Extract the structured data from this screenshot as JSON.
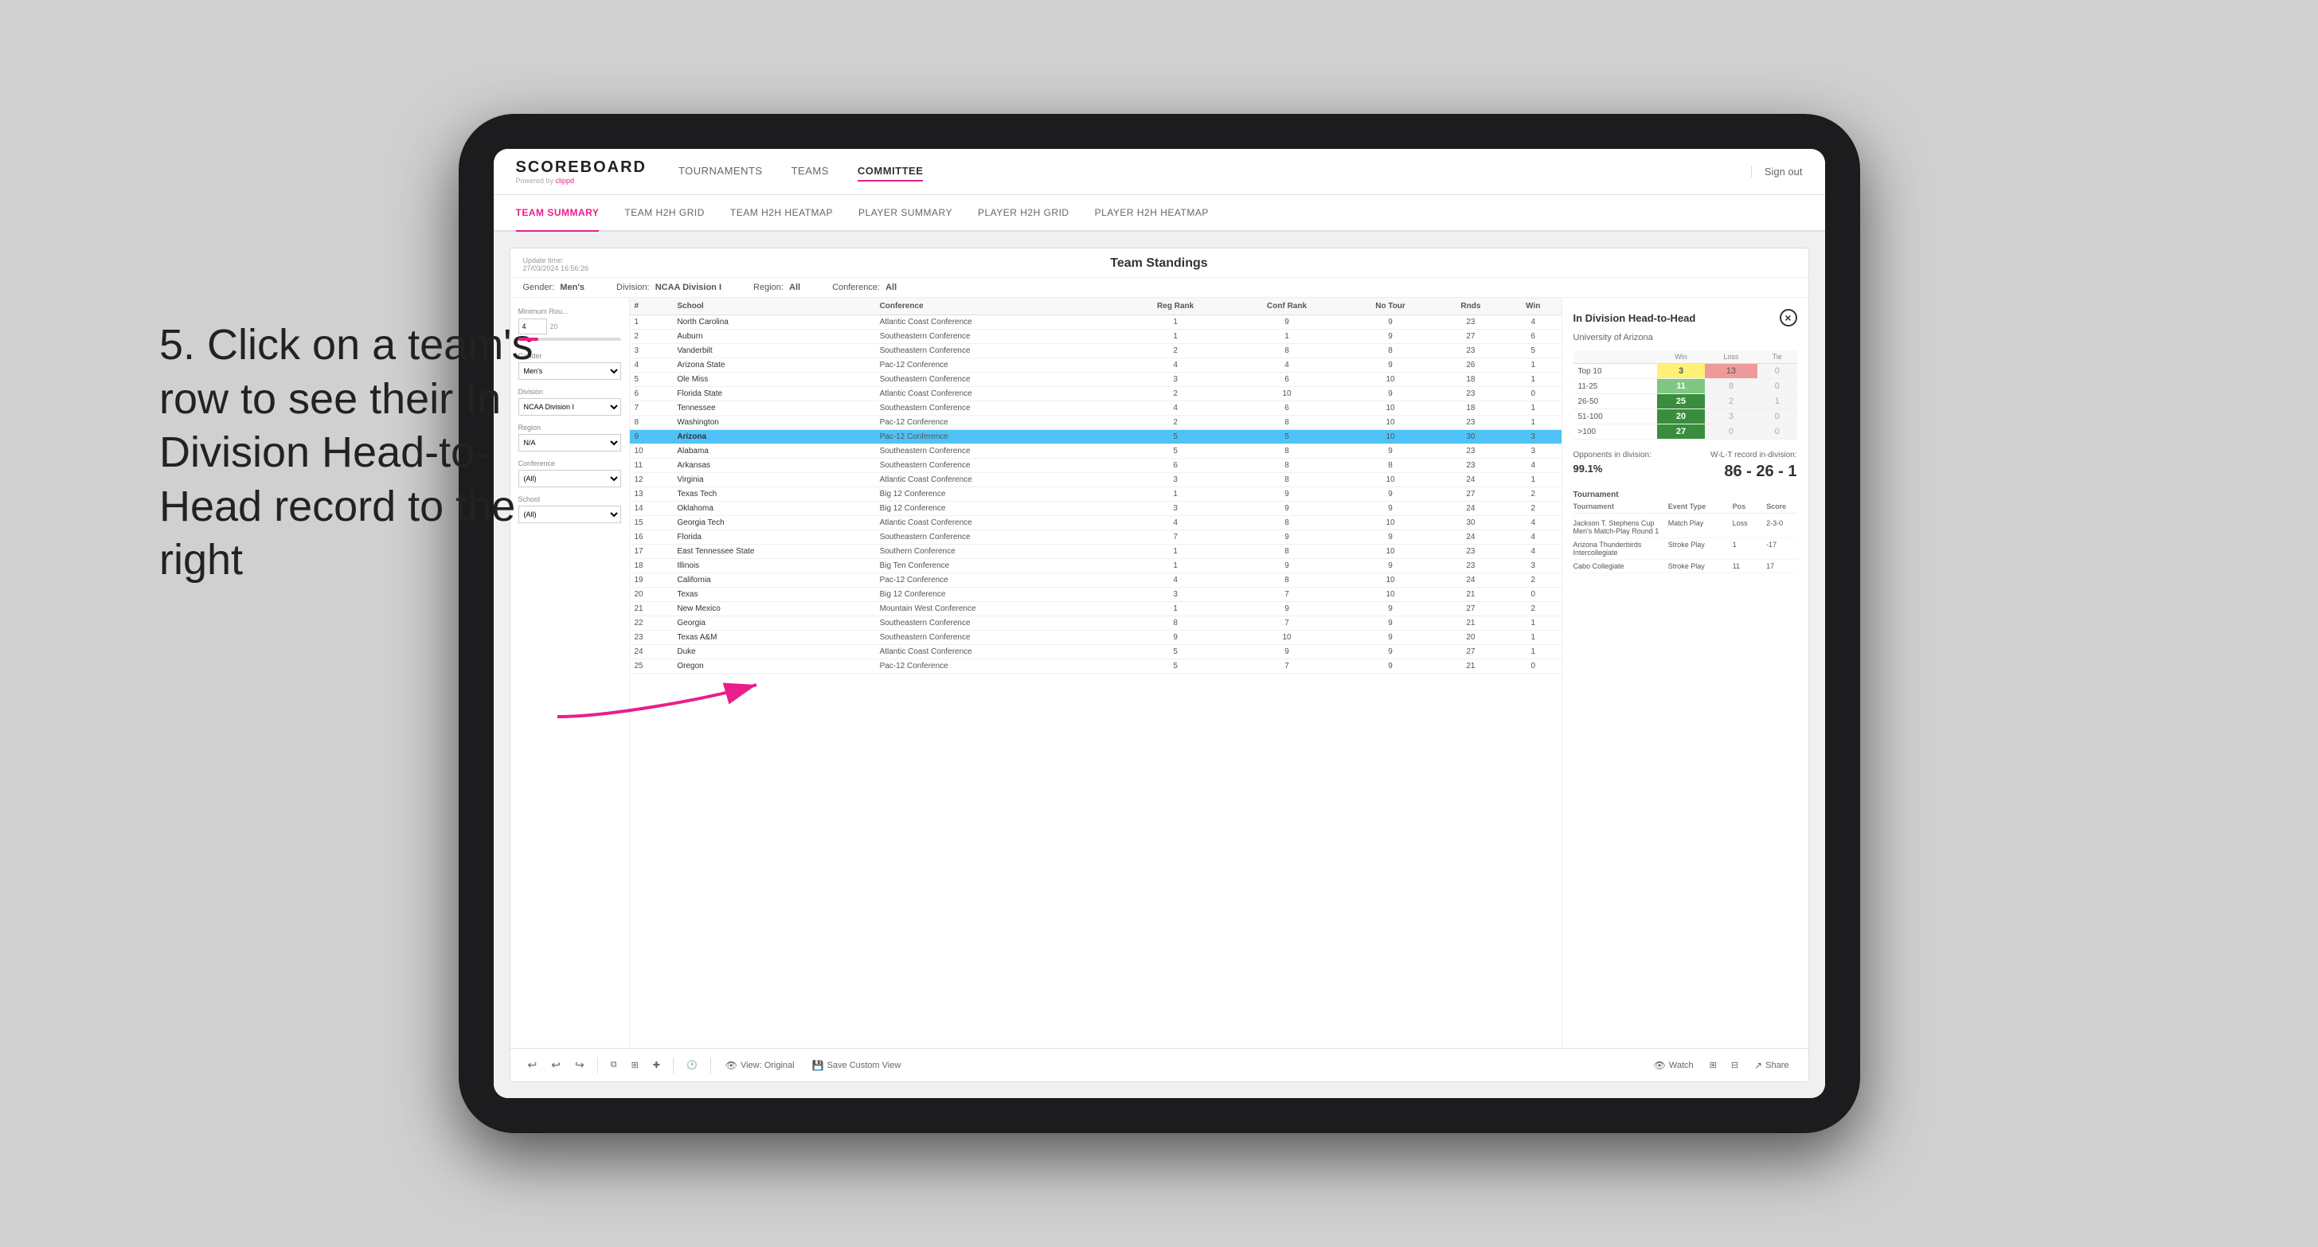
{
  "app": {
    "title": "SCOREBOARD",
    "subtitle": "Powered by clippd",
    "sign_out": "Sign out"
  },
  "main_nav": [
    {
      "id": "tournaments",
      "label": "TOURNAMENTS",
      "active": false
    },
    {
      "id": "teams",
      "label": "TEAMS",
      "active": false
    },
    {
      "id": "committee",
      "label": "COMMITTEE",
      "active": true
    }
  ],
  "sub_nav": [
    {
      "id": "team-summary",
      "label": "TEAM SUMMARY",
      "active": true
    },
    {
      "id": "team-h2h-grid",
      "label": "TEAM H2H GRID",
      "active": false
    },
    {
      "id": "team-h2h-heatmap",
      "label": "TEAM H2H HEATMAP",
      "active": false
    },
    {
      "id": "player-summary",
      "label": "PLAYER SUMMARY",
      "active": false
    },
    {
      "id": "player-h2h-grid",
      "label": "PLAYER H2H GRID",
      "active": false
    },
    {
      "id": "player-h2h-heatmap",
      "label": "PLAYER H2H HEATMAP",
      "active": false
    }
  ],
  "panel": {
    "update_time_label": "Update time:",
    "update_time": "27/03/2024 16:56:26",
    "title": "Team Standings",
    "gender_label": "Gender:",
    "gender": "Men's",
    "division_label": "Division:",
    "division": "NCAA Division I",
    "region_label": "Region:",
    "region": "All",
    "conference_label": "Conference:",
    "conference": "All"
  },
  "filters": {
    "min_rounds_label": "Minimum Rou...",
    "min_rounds_value": "4",
    "min_rounds_max": "20",
    "gender_label": "Gender",
    "gender_value": "Men's",
    "division_label": "Division",
    "division_value": "NCAA Division I",
    "region_label": "Region",
    "region_value": "N/A",
    "conference_label": "Conference",
    "conference_value": "(All)",
    "school_label": "School",
    "school_value": "(All)"
  },
  "table": {
    "columns": [
      "#",
      "School",
      "Conference",
      "Reg Rank",
      "Conf Rank",
      "No Tour",
      "Rnds",
      "Win"
    ],
    "rows": [
      {
        "num": "1",
        "school": "North Carolina",
        "conference": "Atlantic Coast Conference",
        "reg_rank": "1",
        "conf_rank": "9",
        "no_tour": "9",
        "rnds": "23",
        "win": "4"
      },
      {
        "num": "2",
        "school": "Auburn",
        "conference": "Southeastern Conference",
        "reg_rank": "1",
        "conf_rank": "1",
        "no_tour": "9",
        "rnds": "27",
        "win": "6"
      },
      {
        "num": "3",
        "school": "Vanderbilt",
        "conference": "Southeastern Conference",
        "reg_rank": "2",
        "conf_rank": "8",
        "no_tour": "8",
        "rnds": "23",
        "win": "5"
      },
      {
        "num": "4",
        "school": "Arizona State",
        "conference": "Pac-12 Conference",
        "reg_rank": "4",
        "conf_rank": "4",
        "no_tour": "9",
        "rnds": "26",
        "win": "1"
      },
      {
        "num": "5",
        "school": "Ole Miss",
        "conference": "Southeastern Conference",
        "reg_rank": "3",
        "conf_rank": "6",
        "no_tour": "10",
        "rnds": "18",
        "win": "1"
      },
      {
        "num": "6",
        "school": "Florida State",
        "conference": "Atlantic Coast Conference",
        "reg_rank": "2",
        "conf_rank": "10",
        "no_tour": "9",
        "rnds": "23",
        "win": "0"
      },
      {
        "num": "7",
        "school": "Tennessee",
        "conference": "Southeastern Conference",
        "reg_rank": "4",
        "conf_rank": "6",
        "no_tour": "10",
        "rnds": "18",
        "win": "1"
      },
      {
        "num": "8",
        "school": "Washington",
        "conference": "Pac-12 Conference",
        "reg_rank": "2",
        "conf_rank": "8",
        "no_tour": "10",
        "rnds": "23",
        "win": "1"
      },
      {
        "num": "9",
        "school": "Arizona",
        "conference": "Pac-12 Conference",
        "reg_rank": "5",
        "conf_rank": "5",
        "no_tour": "10",
        "rnds": "30",
        "win": "3",
        "selected": true
      },
      {
        "num": "10",
        "school": "Alabama",
        "conference": "Southeastern Conference",
        "reg_rank": "5",
        "conf_rank": "8",
        "no_tour": "9",
        "rnds": "23",
        "win": "3"
      },
      {
        "num": "11",
        "school": "Arkansas",
        "conference": "Southeastern Conference",
        "reg_rank": "6",
        "conf_rank": "8",
        "no_tour": "8",
        "rnds": "23",
        "win": "4"
      },
      {
        "num": "12",
        "school": "Virginia",
        "conference": "Atlantic Coast Conference",
        "reg_rank": "3",
        "conf_rank": "8",
        "no_tour": "10",
        "rnds": "24",
        "win": "1"
      },
      {
        "num": "13",
        "school": "Texas Tech",
        "conference": "Big 12 Conference",
        "reg_rank": "1",
        "conf_rank": "9",
        "no_tour": "9",
        "rnds": "27",
        "win": "2"
      },
      {
        "num": "14",
        "school": "Oklahoma",
        "conference": "Big 12 Conference",
        "reg_rank": "3",
        "conf_rank": "9",
        "no_tour": "9",
        "rnds": "24",
        "win": "2"
      },
      {
        "num": "15",
        "school": "Georgia Tech",
        "conference": "Atlantic Coast Conference",
        "reg_rank": "4",
        "conf_rank": "8",
        "no_tour": "10",
        "rnds": "30",
        "win": "4"
      },
      {
        "num": "16",
        "school": "Florida",
        "conference": "Southeastern Conference",
        "reg_rank": "7",
        "conf_rank": "9",
        "no_tour": "9",
        "rnds": "24",
        "win": "4"
      },
      {
        "num": "17",
        "school": "East Tennessee State",
        "conference": "Southern Conference",
        "reg_rank": "1",
        "conf_rank": "8",
        "no_tour": "10",
        "rnds": "23",
        "win": "4"
      },
      {
        "num": "18",
        "school": "Illinois",
        "conference": "Big Ten Conference",
        "reg_rank": "1",
        "conf_rank": "9",
        "no_tour": "9",
        "rnds": "23",
        "win": "3"
      },
      {
        "num": "19",
        "school": "California",
        "conference": "Pac-12 Conference",
        "reg_rank": "4",
        "conf_rank": "8",
        "no_tour": "10",
        "rnds": "24",
        "win": "2"
      },
      {
        "num": "20",
        "school": "Texas",
        "conference": "Big 12 Conference",
        "reg_rank": "3",
        "conf_rank": "7",
        "no_tour": "10",
        "rnds": "21",
        "win": "0"
      },
      {
        "num": "21",
        "school": "New Mexico",
        "conference": "Mountain West Conference",
        "reg_rank": "1",
        "conf_rank": "9",
        "no_tour": "9",
        "rnds": "27",
        "win": "2"
      },
      {
        "num": "22",
        "school": "Georgia",
        "conference": "Southeastern Conference",
        "reg_rank": "8",
        "conf_rank": "7",
        "no_tour": "9",
        "rnds": "21",
        "win": "1"
      },
      {
        "num": "23",
        "school": "Texas A&M",
        "conference": "Southeastern Conference",
        "reg_rank": "9",
        "conf_rank": "10",
        "no_tour": "9",
        "rnds": "20",
        "win": "1"
      },
      {
        "num": "24",
        "school": "Duke",
        "conference": "Atlantic Coast Conference",
        "reg_rank": "5",
        "conf_rank": "9",
        "no_tour": "9",
        "rnds": "27",
        "win": "1"
      },
      {
        "num": "25",
        "school": "Oregon",
        "conference": "Pac-12 Conference",
        "reg_rank": "5",
        "conf_rank": "7",
        "no_tour": "9",
        "rnds": "21",
        "win": "0"
      }
    ]
  },
  "h2h": {
    "title": "In Division Head-to-Head",
    "team": "University of Arizona",
    "close_label": "×",
    "columns": [
      "Win",
      "Loss",
      "Tie"
    ],
    "rows": [
      {
        "label": "Top 10",
        "win": "3",
        "loss": "13",
        "tie": "0",
        "win_class": "cell-yellow",
        "loss_class": "cell-red"
      },
      {
        "label": "11-25",
        "win": "11",
        "loss": "8",
        "tie": "0",
        "win_class": "cell-green",
        "loss_class": "cell-gray"
      },
      {
        "label": "26-50",
        "win": "25",
        "loss": "2",
        "tie": "1",
        "win_class": "cell-dark-green",
        "loss_class": "cell-gray"
      },
      {
        "label": "51-100",
        "win": "20",
        "loss": "3",
        "tie": "0",
        "win_class": "cell-dark-green",
        "loss_class": "cell-gray"
      },
      {
        "label": ">100",
        "win": "27",
        "loss": "0",
        "tie": "0",
        "win_class": "cell-dark-green",
        "loss_class": "cell-gray"
      }
    ],
    "opponents_label": "Opponents in division:",
    "opponents_value": "99.1%",
    "wlt_label": "W-L-T record in-division:",
    "wlt_value": "86 - 26 - 1",
    "tournament_header": [
      "Tournament",
      "Event Type",
      "Pos",
      "Score"
    ],
    "tournaments": [
      {
        "name": "Jackson T. Stephens Cup Men's Match-Play Round 1",
        "type": "Match Play",
        "pos": "Loss",
        "score": "2-3-0"
      },
      {
        "name": "Arizona Thunderbirds Intercollegiate",
        "type": "Stroke Play",
        "pos": "1",
        "score": "-17"
      },
      {
        "name": "Cabo Collegiate",
        "type": "Stroke Play",
        "pos": "11",
        "score": "17"
      }
    ]
  },
  "toolbar": {
    "view_original": "View: Original",
    "save_custom_view": "Save Custom View",
    "watch": "Watch",
    "share": "Share"
  },
  "annotation": {
    "text": "5. Click on a team's row to see their In Division Head-to-Head record to the right"
  }
}
